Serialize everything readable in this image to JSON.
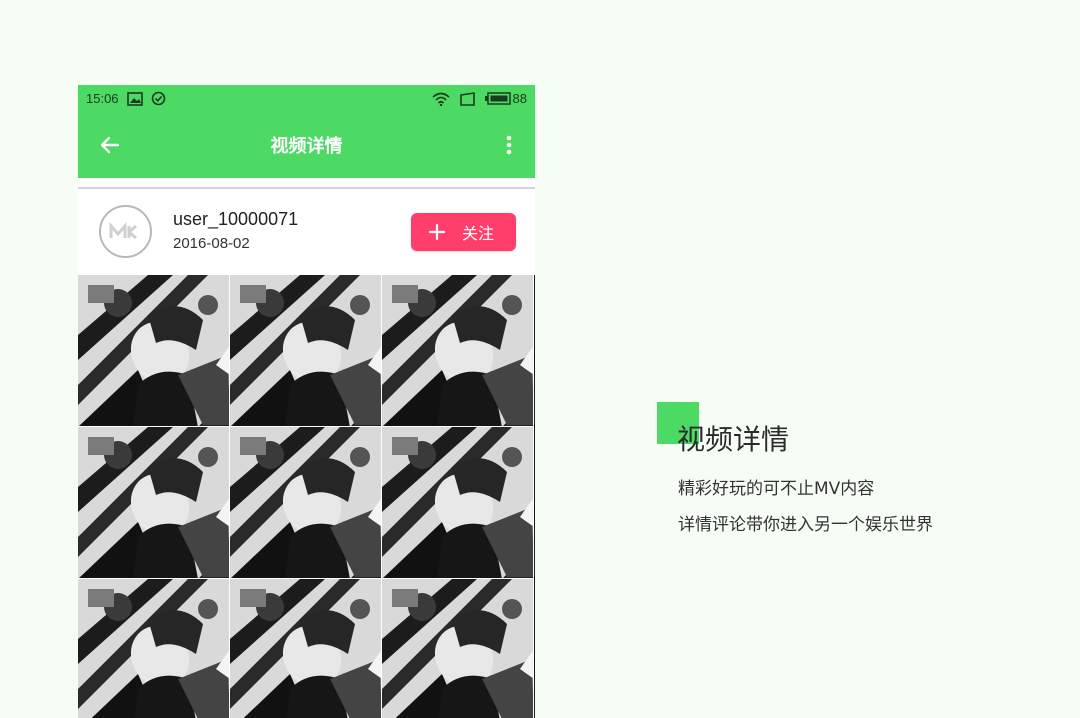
{
  "status_bar": {
    "time": "15:06",
    "battery": "88"
  },
  "app_bar": {
    "title": "视频详情"
  },
  "user": {
    "name": "user_10000071",
    "date": "2016-08-02",
    "follow_label": "关注"
  },
  "feature": {
    "title": "视频详情",
    "line1": "精彩好玩的可不止MV内容",
    "line2": "详情评论带你进入另一个娱乐世界"
  },
  "colors": {
    "brand_green": "#4cd964",
    "follow_pink": "#ff3e6c",
    "page_background": "#f6fdf5"
  },
  "icons": {
    "back": "arrow-left-icon",
    "more": "more-vertical-icon",
    "follow": "plus-icon",
    "status_left": [
      "image-icon",
      "check-circle-icon"
    ],
    "status_right": [
      "wifi-icon",
      "screen-icon",
      "battery-icon"
    ]
  }
}
